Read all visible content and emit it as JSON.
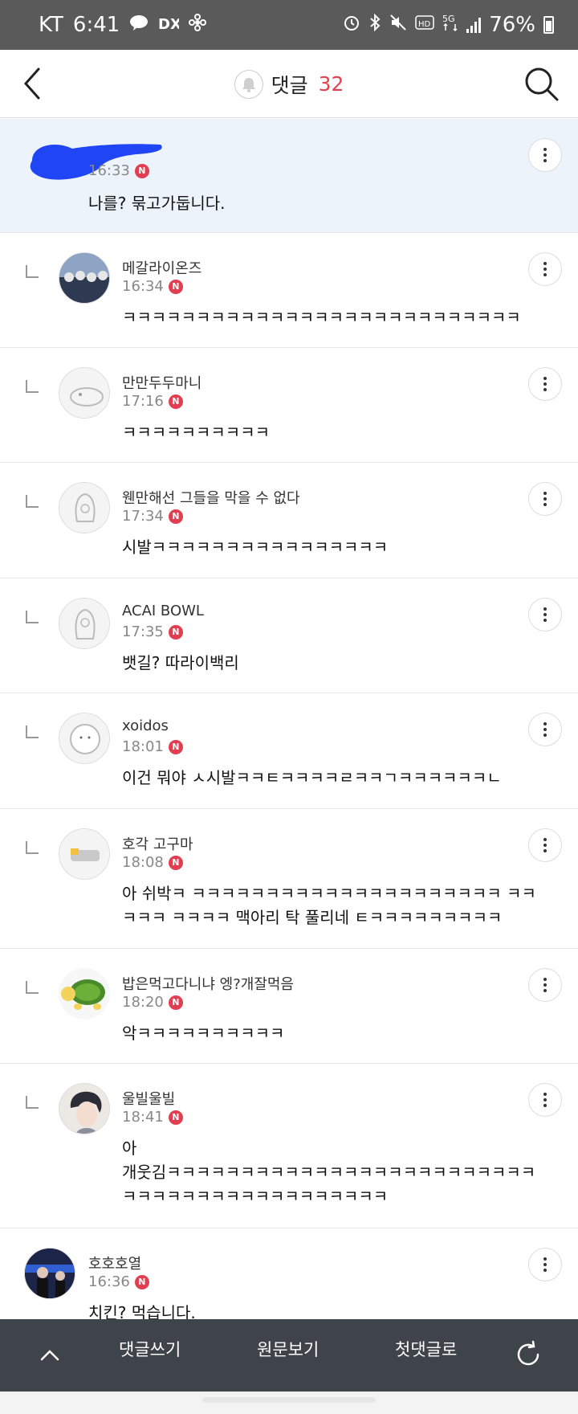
{
  "status_bar": {
    "carrier": "KT",
    "time": "6:41",
    "battery": "76%",
    "notification_icons": [
      "talk-icon",
      "dx-icon",
      "pinwheel-icon"
    ],
    "system_icons": [
      "alarm-icon",
      "bluetooth-icon",
      "mute-icon",
      "hd-icon",
      "5g-icon",
      "signal-icon",
      "battery-icon"
    ]
  },
  "header": {
    "title": "댓글",
    "count": "32",
    "count_color": "#e4404f"
  },
  "comments": [
    {
      "name": "",
      "time": "16:33",
      "text": "나를? 묶고가둡니다.",
      "reply": false,
      "highlight": true,
      "new_badge": "N"
    },
    {
      "name": "메갈라이온즈",
      "time": "16:34",
      "text": "ㅋㅋㅋㅋㅋㅋㅋㅋㅋㅋㅋㅋㅋㅋㅋㅋㅋㅋㅋㅋㅋㅋㅋㅋㅋㅋㅋ",
      "reply": true,
      "new_badge": "N"
    },
    {
      "name": "만만두두마니",
      "time": "17:16",
      "text": "ㅋㅋㅋㅋㅋㅋㅋㅋㅋㅋ",
      "reply": true,
      "new_badge": "N"
    },
    {
      "name": "웬만해선 그들을 막을 수 없다",
      "time": "17:34",
      "text": "시발ㅋㅋㅋㅋㅋㅋㅋㅋㅋㅋㅋㅋㅋㅋㅋㅋ",
      "reply": true,
      "new_badge": "N"
    },
    {
      "name": "ACAI BOWL",
      "time": "17:35",
      "text": "뱃길? 따라이백리",
      "reply": true,
      "new_badge": "N"
    },
    {
      "name": "xoidos",
      "time": "18:01",
      "text": "이건 뭐야 ㅅ시발ㅋㅋㅌㅋㅋㅋㅋㄹㅋㅋㄱㅋㅋㅋㅋㅋㅋㄴ",
      "reply": true,
      "new_badge": "N"
    },
    {
      "name": "호각 고구마",
      "time": "18:08",
      "text_lines": [
        "아 쉬박ㅋ ㅋㅋㅋㅋㅋㅋㅋㅋㅋㅋㅋㅋㅋㅋㅋㅋㅋㅋㅋㅋㅋ ㅋㅋ",
        "ㅋㅋㅋ ㅋㅋㅋㅋ 맥아리 탁 풀리네 ㅌㅋㅋㅋㅋㅋㅋㅋㅋㅋ"
      ],
      "reply": true,
      "new_badge": "N"
    },
    {
      "name": "밥은먹고다니냐 엥?개잘먹음",
      "time": "18:20",
      "text": "악ㅋㅋㅋㅋㅋㅋㅋㅋㅋㅋ",
      "reply": true,
      "new_badge": "N"
    },
    {
      "name": "울빌울빌",
      "time": "18:41",
      "text_lines": [
        "아",
        "개웃김ㅋㅋㅋㅋㅋㅋㅋㅋㅋㅋㅋㅋㅋㅋㅋㅋㅋㅋㅋㅋㅋㅋㅋㅋㅋ",
        "ㅋㅋㅋㅋㅋㅋㅋㅋㅋㅋㅋㅋㅋㅋㅋㅋㅋㅋ"
      ],
      "reply": true,
      "new_badge": "N"
    },
    {
      "name": "호호호열",
      "time": "16:36",
      "text": "치킨? 먹습니다.",
      "reply": false,
      "new_badge": "N"
    }
  ],
  "bottom_bar": {
    "write_label": "댓글쓰기",
    "original_label": "원문보기",
    "first_label": "첫댓글로"
  }
}
